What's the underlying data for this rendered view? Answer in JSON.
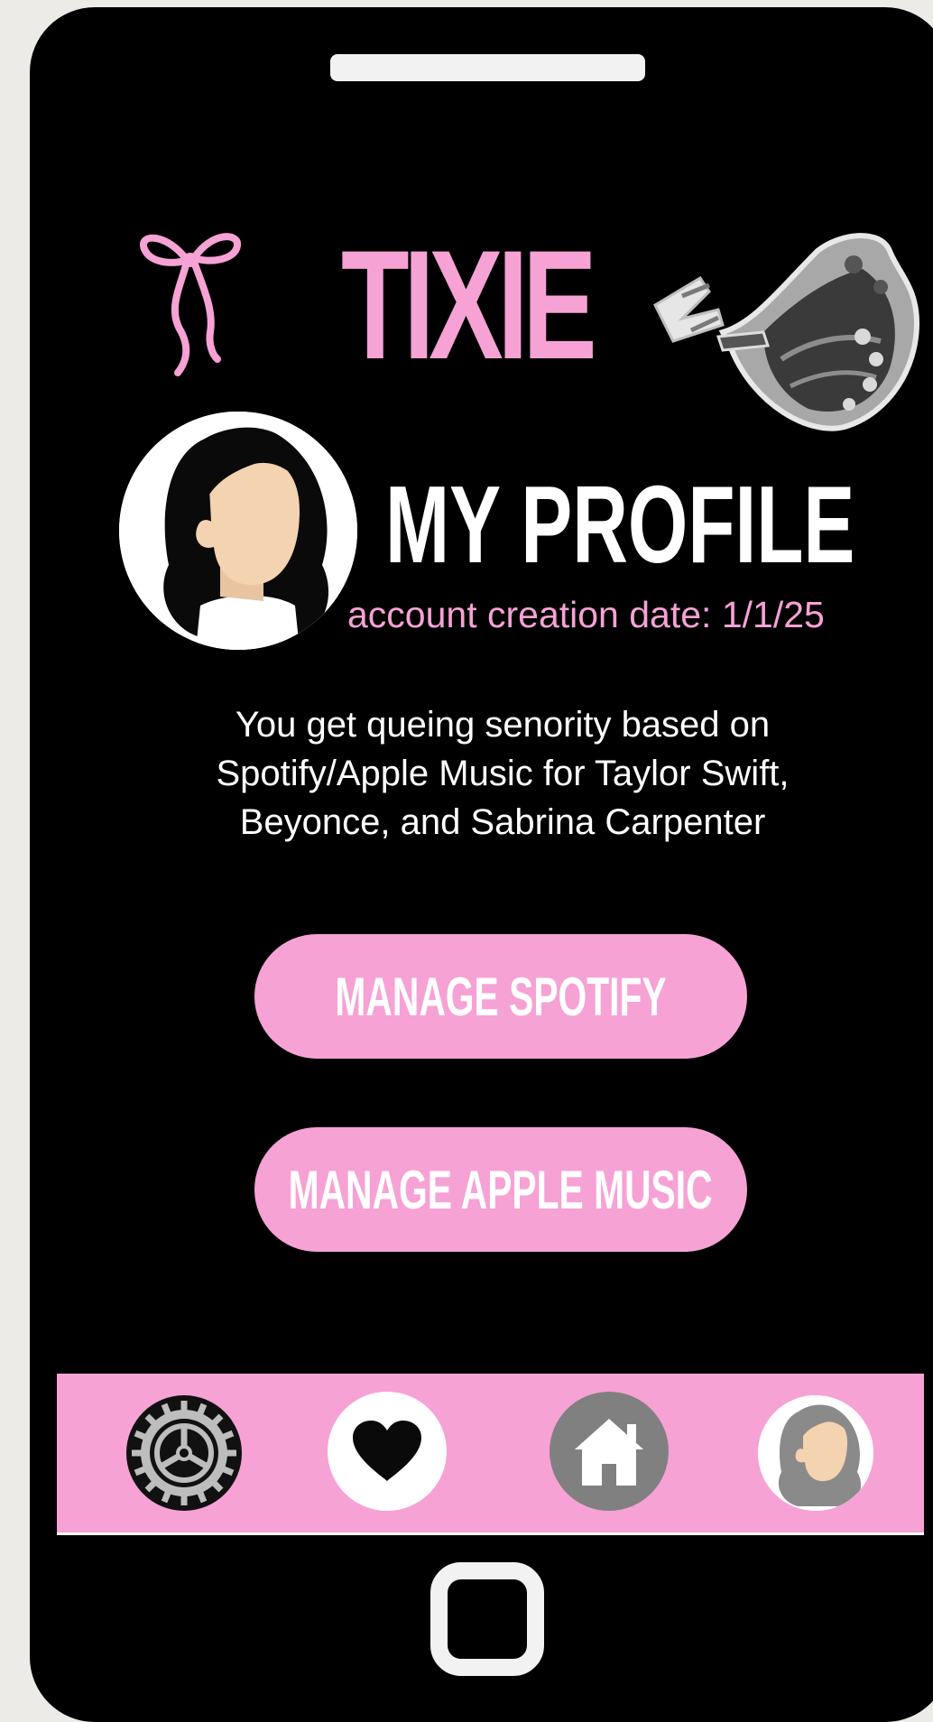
{
  "app": {
    "brand": "TIXIE"
  },
  "profile": {
    "title": "MY PROFILE",
    "account_created": "account creation date: 1/1/25",
    "info_lines": [
      "You get queing senority based on",
      "Spotify/Apple Music for Taylor Swift,",
      "Beyonce, and Sabrina Carpenter"
    ]
  },
  "actions": {
    "spotify_label": "MANAGE SPOTIFY",
    "apple_label": "MANAGE APPLE MUSIC"
  },
  "nav": {
    "items": [
      {
        "id": "settings",
        "icon": "gear-icon"
      },
      {
        "id": "favorites",
        "icon": "heart-icon"
      },
      {
        "id": "home",
        "icon": "house-icon"
      },
      {
        "id": "profile",
        "icon": "avatar-icon"
      }
    ]
  },
  "colors": {
    "accent_pink": "#f6a2d5",
    "phone_body": "#000000",
    "text_white": "#ffffff",
    "home_icon_bg": "#808080",
    "skin": "#f3d3b0"
  }
}
